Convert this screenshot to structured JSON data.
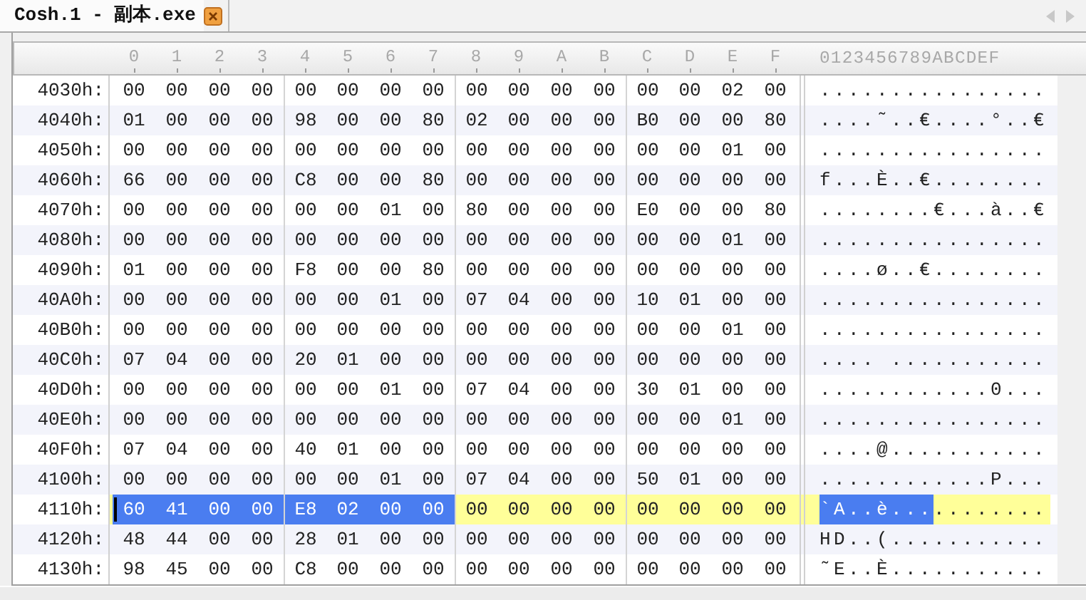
{
  "tab": {
    "title": "Cosh.1 - 副本.exe"
  },
  "header": {
    "columns": [
      "0",
      "1",
      "2",
      "3",
      "4",
      "5",
      "6",
      "7",
      "8",
      "9",
      "A",
      "B",
      "C",
      "D",
      "E",
      "F"
    ],
    "ascii": "0123456789ABCDEF"
  },
  "rows": [
    {
      "offset": "4030h:",
      "current": false,
      "segments": [
        {
          "selected": false,
          "bytes": [
            "00",
            "00",
            "00",
            "00",
            "00",
            "00",
            "00",
            "00",
            "00",
            "00",
            "00",
            "00",
            "00",
            "00",
            "02",
            "00"
          ],
          "ascii": "................"
        }
      ]
    },
    {
      "offset": "4040h:",
      "current": false,
      "segments": [
        {
          "selected": false,
          "bytes": [
            "01",
            "00",
            "00",
            "00",
            "98",
            "00",
            "00",
            "80",
            "02",
            "00",
            "00",
            "00",
            "B0",
            "00",
            "00",
            "80"
          ],
          "ascii": "....˜..€....°..€"
        }
      ]
    },
    {
      "offset": "4050h:",
      "current": false,
      "segments": [
        {
          "selected": false,
          "bytes": [
            "00",
            "00",
            "00",
            "00",
            "00",
            "00",
            "00",
            "00",
            "00",
            "00",
            "00",
            "00",
            "00",
            "00",
            "01",
            "00"
          ],
          "ascii": "................"
        }
      ]
    },
    {
      "offset": "4060h:",
      "current": false,
      "segments": [
        {
          "selected": false,
          "bytes": [
            "66",
            "00",
            "00",
            "00",
            "C8",
            "00",
            "00",
            "80",
            "00",
            "00",
            "00",
            "00",
            "00",
            "00",
            "00",
            "00"
          ],
          "ascii": "f...È..€........"
        }
      ]
    },
    {
      "offset": "4070h:",
      "current": false,
      "segments": [
        {
          "selected": false,
          "bytes": [
            "00",
            "00",
            "00",
            "00",
            "00",
            "00",
            "01",
            "00",
            "80",
            "00",
            "00",
            "00",
            "E0",
            "00",
            "00",
            "80"
          ],
          "ascii": "........€...à..€"
        }
      ]
    },
    {
      "offset": "4080h:",
      "current": false,
      "segments": [
        {
          "selected": false,
          "bytes": [
            "00",
            "00",
            "00",
            "00",
            "00",
            "00",
            "00",
            "00",
            "00",
            "00",
            "00",
            "00",
            "00",
            "00",
            "01",
            "00"
          ],
          "ascii": "................"
        }
      ]
    },
    {
      "offset": "4090h:",
      "current": false,
      "segments": [
        {
          "selected": false,
          "bytes": [
            "01",
            "00",
            "00",
            "00",
            "F8",
            "00",
            "00",
            "80",
            "00",
            "00",
            "00",
            "00",
            "00",
            "00",
            "00",
            "00"
          ],
          "ascii": "....ø..€........"
        }
      ]
    },
    {
      "offset": "40A0h:",
      "current": false,
      "segments": [
        {
          "selected": false,
          "bytes": [
            "00",
            "00",
            "00",
            "00",
            "00",
            "00",
            "01",
            "00",
            "07",
            "04",
            "00",
            "00",
            "10",
            "01",
            "00",
            "00"
          ],
          "ascii": "................"
        }
      ]
    },
    {
      "offset": "40B0h:",
      "current": false,
      "segments": [
        {
          "selected": false,
          "bytes": [
            "00",
            "00",
            "00",
            "00",
            "00",
            "00",
            "00",
            "00",
            "00",
            "00",
            "00",
            "00",
            "00",
            "00",
            "01",
            "00"
          ],
          "ascii": "................"
        }
      ]
    },
    {
      "offset": "40C0h:",
      "current": false,
      "segments": [
        {
          "selected": false,
          "bytes": [
            "07",
            "04",
            "00",
            "00",
            "20",
            "01",
            "00",
            "00",
            "00",
            "00",
            "00",
            "00",
            "00",
            "00",
            "00",
            "00"
          ],
          "ascii": ".... ..........."
        }
      ]
    },
    {
      "offset": "40D0h:",
      "current": false,
      "segments": [
        {
          "selected": false,
          "bytes": [
            "00",
            "00",
            "00",
            "00",
            "00",
            "00",
            "01",
            "00",
            "07",
            "04",
            "00",
            "00",
            "30",
            "01",
            "00",
            "00"
          ],
          "ascii": "............0..."
        }
      ]
    },
    {
      "offset": "40E0h:",
      "current": false,
      "segments": [
        {
          "selected": false,
          "bytes": [
            "00",
            "00",
            "00",
            "00",
            "00",
            "00",
            "00",
            "00",
            "00",
            "00",
            "00",
            "00",
            "00",
            "00",
            "01",
            "00"
          ],
          "ascii": "................"
        }
      ]
    },
    {
      "offset": "40F0h:",
      "current": false,
      "segments": [
        {
          "selected": false,
          "bytes": [
            "07",
            "04",
            "00",
            "00",
            "40",
            "01",
            "00",
            "00",
            "00",
            "00",
            "00",
            "00",
            "00",
            "00",
            "00",
            "00"
          ],
          "ascii": "....@..........."
        }
      ]
    },
    {
      "offset": "4100h:",
      "current": false,
      "segments": [
        {
          "selected": false,
          "bytes": [
            "00",
            "00",
            "00",
            "00",
            "00",
            "00",
            "01",
            "00",
            "07",
            "04",
            "00",
            "00",
            "50",
            "01",
            "00",
            "00"
          ],
          "ascii": "............P..."
        }
      ]
    },
    {
      "offset": "4110h:",
      "current": true,
      "segments": [
        {
          "selected": true,
          "bytes": [
            "60",
            "41",
            "00",
            "00",
            "E8",
            "02",
            "00",
            "00"
          ],
          "ascii": "`A..è..."
        },
        {
          "selected": false,
          "bytes": [
            "00",
            "00",
            "00",
            "00",
            "00",
            "00",
            "00",
            "00"
          ],
          "ascii": "........"
        }
      ]
    },
    {
      "offset": "4120h:",
      "current": false,
      "segments": [
        {
          "selected": false,
          "bytes": [
            "48",
            "44",
            "00",
            "00",
            "28",
            "01",
            "00",
            "00",
            "00",
            "00",
            "00",
            "00",
            "00",
            "00",
            "00",
            "00"
          ],
          "ascii": "HD..(..........."
        }
      ]
    },
    {
      "offset": "4130h:",
      "current": false,
      "segments": [
        {
          "selected": false,
          "bytes": [
            "98",
            "45",
            "00",
            "00",
            "C8",
            "00",
            "00",
            "00",
            "00",
            "00",
            "00",
            "00",
            "00",
            "00",
            "00",
            "00"
          ],
          "ascii": "˜E..È..........."
        }
      ]
    }
  ]
}
